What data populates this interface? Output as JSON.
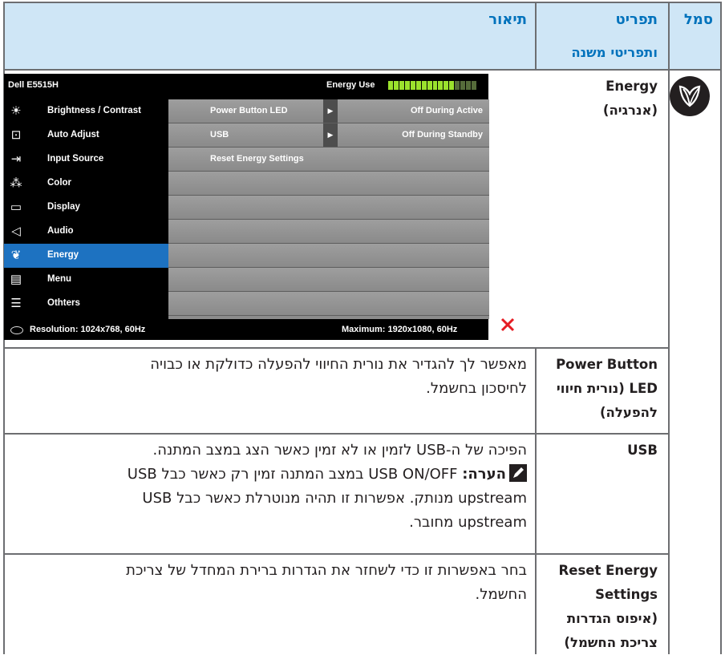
{
  "header": {
    "col_symbol": "סמל",
    "col_menu": "תפריט",
    "col_submenu": "ותפריטי משנה",
    "col_description": "תיאור"
  },
  "rows": [
    {
      "feature_lines": [
        "Energy",
        "(אנרגיה)"
      ]
    },
    {
      "feature_lines": [
        "Power Button",
        "LED (נורית חיווי",
        "להפעלה)"
      ],
      "desc_lines": [
        "מאפשר לך להגדיר את נורית החיווי להפעלה כדולקת או כבויה",
        "לחיסכון בחשמל."
      ]
    },
    {
      "feature_lines": [
        "USB"
      ],
      "desc_lines": [
        "הפיכה של ה-USB לזמין או לא זמין כאשר הצג במצב המתנה."
      ],
      "note_label": "הערה:",
      "note_icon": "pencil-icon",
      "note_lines": [
        "USB ON/OFF במצב המתנה זמין רק כאשר כבל USB",
        "upstream מנותק. אפשרות זו תהיה מנוטרלת כאשר כבל USB",
        "upstream מחובר."
      ]
    },
    {
      "feature_lines": [
        "Reset Energy",
        "Settings",
        "(איפוס הגדרות",
        "צריכת החשמל)"
      ],
      "desc_lines": [
        "בחר באפשרות זו כדי לשחזר את הגדרות ברירת המחדל של צריכת",
        "החשמל."
      ]
    }
  ],
  "osd": {
    "model": "Dell E5515H",
    "energy_use_label": "Energy Use",
    "energy_meter_level": 0.78,
    "menu_items": [
      {
        "label": "Brightness / Contrast",
        "icon": "brightness-icon"
      },
      {
        "label": "Auto Adjust",
        "icon": "auto-adjust-icon"
      },
      {
        "label": "Input Source",
        "icon": "input-source-icon"
      },
      {
        "label": "Color",
        "icon": "color-icon"
      },
      {
        "label": "Display",
        "icon": "display-icon"
      },
      {
        "label": "Audio",
        "icon": "audio-icon"
      },
      {
        "label": "Energy",
        "icon": "energy-icon",
        "selected": true
      },
      {
        "label": "Menu",
        "icon": "menu-icon"
      },
      {
        "label": "Othters",
        "icon": "others-icon"
      }
    ],
    "submenu_rows": [
      {
        "label": "Power Button LED",
        "has_arrow": true,
        "value": "Off During Active"
      },
      {
        "label": "USB",
        "has_arrow": true,
        "value": "Off During Standby"
      },
      {
        "label": "Reset Energy Settings",
        "has_arrow": false,
        "value": ""
      }
    ],
    "resolution": "Resolution: 1024x768, 60Hz",
    "maximum": "Maximum: 1920x1080, 60Hz",
    "nav_buttons": [
      "up-icon",
      "down-icon",
      "right-arrow-icon",
      "close-icon"
    ],
    "colors": {
      "selected": "#1d72c1",
      "meter_on": "#9be22d",
      "close": "#e51c23"
    }
  },
  "colors": {
    "header_bg": "#cfe6f6",
    "header_text": "#0072bc",
    "grid_line": "#6d6e71"
  }
}
